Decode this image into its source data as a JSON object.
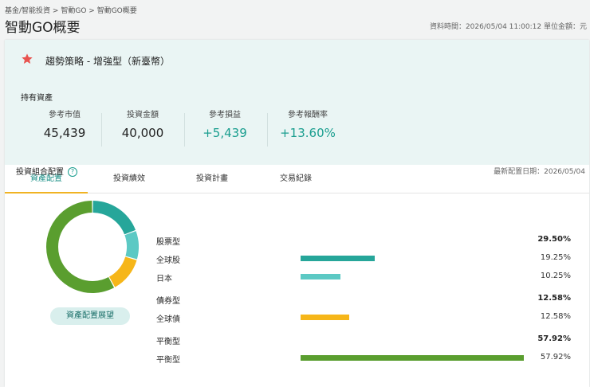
{
  "breadcrumb": [
    "基金/智能投資",
    ">",
    "智動GO",
    ">",
    "智動GO概要"
  ],
  "page_title": "智動GO概要",
  "meta": {
    "data_time": "資料時間：2026/05/04 11:00:12",
    "unit": "單位金額：元"
  },
  "strategy_name": "趨勢策略 - 增強型（新臺幣）",
  "assets_label": "持有資產",
  "metrics": [
    {
      "label": "參考市值",
      "value": "45,439",
      "positive": false
    },
    {
      "label": "投資金額",
      "value": "40,000",
      "positive": false
    },
    {
      "label": "參考損益",
      "value": "+5,439",
      "positive": true
    },
    {
      "label": "參考報酬率",
      "value": "+13.60%",
      "positive": true
    }
  ],
  "tabs": [
    {
      "label": "資產配置",
      "active": true
    },
    {
      "label": "投資績效",
      "active": false
    },
    {
      "label": "投資計畫",
      "active": false
    },
    {
      "label": "交易紀錄",
      "active": false
    }
  ],
  "section_title": "投資組合配置",
  "help_icon": "?",
  "latest_date": "最新配置日期：2026/05/04",
  "expand_button": "資產配置展望",
  "colors": {
    "teal_dark": "#26a69a",
    "teal_light": "#5cc9c4",
    "yellow": "#f6b619",
    "green": "#5a9e2f"
  },
  "allocation": [
    {
      "group": "股票型",
      "percent": "29.50%",
      "items": [
        {
          "name": "全球股",
          "percent": "19.25%",
          "value": 19.25,
          "color": "#26a69a"
        },
        {
          "name": "日本",
          "percent": "10.25%",
          "value": 10.25,
          "color": "#5cc9c4"
        }
      ]
    },
    {
      "group": "債券型",
      "percent": "12.58%",
      "items": [
        {
          "name": "全球債",
          "percent": "12.58%",
          "value": 12.58,
          "color": "#f6b619"
        }
      ]
    },
    {
      "group": "平衡型",
      "percent": "57.92%",
      "items": [
        {
          "name": "平衡型",
          "percent": "57.92%",
          "value": 57.92,
          "color": "#5a9e2f"
        }
      ]
    }
  ]
}
